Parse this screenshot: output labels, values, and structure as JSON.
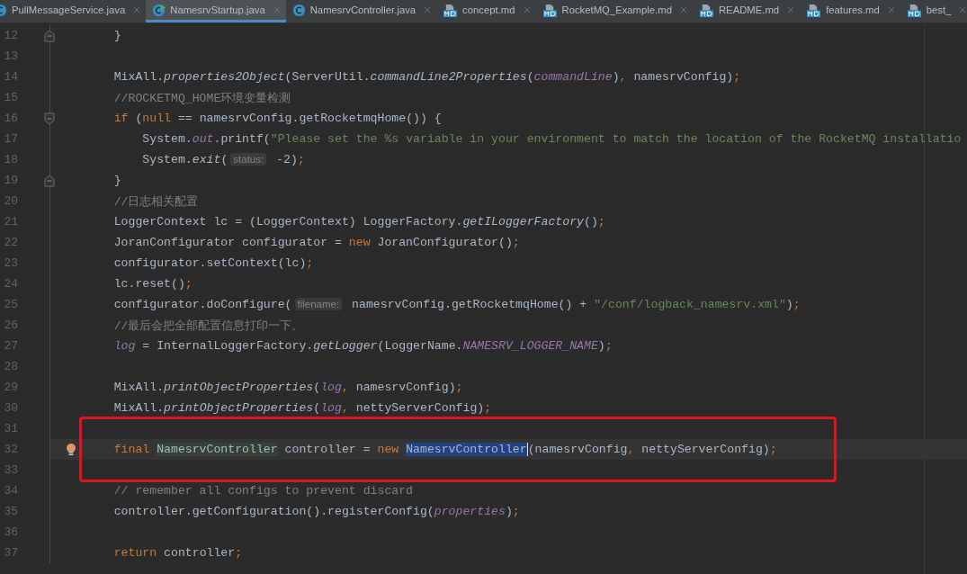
{
  "tabs": [
    {
      "label": "PullMessageService.java",
      "kind": "class",
      "selected": false
    },
    {
      "label": "NamesrvStartup.java",
      "kind": "runnable",
      "selected": true
    },
    {
      "label": "NamesrvController.java",
      "kind": "class",
      "selected": false
    },
    {
      "label": "concept.md",
      "kind": "markdown",
      "selected": false
    },
    {
      "label": "RocketMQ_Example.md",
      "kind": "markdown",
      "selected": false
    },
    {
      "label": "README.md",
      "kind": "markdown",
      "selected": false
    },
    {
      "label": "features.md",
      "kind": "markdown",
      "selected": false
    },
    {
      "label": "best_",
      "kind": "markdown",
      "selected": false
    }
  ],
  "editor": {
    "lines": [
      {
        "number": "12",
        "kind": "closer",
        "tokens": [
          {
            "kind": "plain",
            "text": "    }"
          }
        ]
      },
      {
        "number": "13",
        "kind": "plain"
      },
      {
        "number": "14",
        "kind": "plain",
        "tokens": [
          {
            "kind": "plain",
            "text": "    MixAll."
          },
          {
            "kind": "method",
            "text": "properties2Object"
          },
          {
            "kind": "plain",
            "text": "(ServerUtil."
          },
          {
            "kind": "method",
            "text": "commandLine2Properties"
          },
          {
            "kind": "plain",
            "text": "("
          },
          {
            "kind": "field",
            "text": "commandLine"
          },
          {
            "kind": "plain",
            "text": ")"
          },
          {
            "kind": "punct",
            "text": ", "
          },
          {
            "kind": "plain",
            "text": "namesrvConfig)"
          },
          {
            "kind": "punct",
            "text": ";"
          }
        ]
      },
      {
        "number": "15",
        "kind": "plain",
        "tokens": [
          {
            "kind": "comment",
            "text": "    //ROCKETMQ_HOME环境变量检测"
          }
        ]
      },
      {
        "number": "16",
        "kind": "opener",
        "tokens": [
          {
            "kind": "keyword",
            "text": "    if "
          },
          {
            "kind": "plain",
            "text": "("
          },
          {
            "kind": "keyword",
            "text": "null "
          },
          {
            "kind": "plain",
            "text": "== namesrvConfig.getRocketmqHome()) {"
          }
        ]
      },
      {
        "number": "17",
        "kind": "plain",
        "tokens": [
          {
            "kind": "plain",
            "text": "        System."
          },
          {
            "kind": "field",
            "text": "out"
          },
          {
            "kind": "plain",
            "text": ".printf("
          },
          {
            "kind": "string",
            "text": "\"Please set the %s variable in your environment to match the location of the RocketMQ installatio"
          }
        ]
      },
      {
        "number": "18",
        "kind": "plain",
        "tokens": [
          {
            "kind": "plain",
            "text": "        System."
          },
          {
            "kind": "method",
            "text": "exit"
          },
          {
            "kind": "plain",
            "text": "("
          },
          {
            "kind": "hint",
            "text": "status:"
          },
          {
            "kind": "plain",
            "text": " -2)"
          },
          {
            "kind": "punct",
            "text": ";"
          }
        ]
      },
      {
        "number": "19",
        "kind": "closer",
        "tokens": [
          {
            "kind": "plain",
            "text": "    }"
          }
        ]
      },
      {
        "number": "20",
        "kind": "plain",
        "tokens": [
          {
            "kind": "comment",
            "text": "    //日志相关配置"
          }
        ]
      },
      {
        "number": "21",
        "kind": "plain",
        "tokens": [
          {
            "kind": "plain",
            "text": "    LoggerContext lc = (LoggerContext) LoggerFactory."
          },
          {
            "kind": "method",
            "text": "getILoggerFactory"
          },
          {
            "kind": "plain",
            "text": "()"
          },
          {
            "kind": "punct",
            "text": ";"
          }
        ]
      },
      {
        "number": "22",
        "kind": "plain",
        "tokens": [
          {
            "kind": "plain",
            "text": "    JoranConfigurator configurator = "
          },
          {
            "kind": "keyword",
            "text": "new "
          },
          {
            "kind": "plain",
            "text": "JoranConfigurator()"
          },
          {
            "kind": "punct",
            "text": ";"
          }
        ]
      },
      {
        "number": "23",
        "kind": "plain",
        "tokens": [
          {
            "kind": "plain",
            "text": "    configurator.setContext(lc)"
          },
          {
            "kind": "punct",
            "text": ";"
          }
        ]
      },
      {
        "number": "24",
        "kind": "plain",
        "tokens": [
          {
            "kind": "plain",
            "text": "    lc.reset()"
          },
          {
            "kind": "punct",
            "text": ";"
          }
        ]
      },
      {
        "number": "25",
        "kind": "plain",
        "tokens": [
          {
            "kind": "plain",
            "text": "    configurator.doConfigure("
          },
          {
            "kind": "hint",
            "text": "filename:"
          },
          {
            "kind": "plain",
            "text": " namesrvConfig.getRocketmqHome() + "
          },
          {
            "kind": "string",
            "text": "\"/conf/logback_namesrv.xml\""
          },
          {
            "kind": "plain",
            "text": ")"
          },
          {
            "kind": "punct",
            "text": ";"
          }
        ]
      },
      {
        "number": "26",
        "kind": "plain",
        "tokens": [
          {
            "kind": "comment",
            "text": "    //最后会把全部配置信息打印一下。"
          }
        ]
      },
      {
        "number": "27",
        "kind": "plain",
        "tokens": [
          {
            "kind": "field",
            "text": "    log"
          },
          {
            "kind": "plain",
            "text": " = InternalLoggerFactory."
          },
          {
            "kind": "method",
            "text": "getLogger"
          },
          {
            "kind": "plain",
            "text": "(LoggerName."
          },
          {
            "kind": "field",
            "text": "NAMESRV_LOGGER_NAME"
          },
          {
            "kind": "plain",
            "text": ")"
          },
          {
            "kind": "punct",
            "text": ";"
          }
        ]
      },
      {
        "number": "28",
        "kind": "plain"
      },
      {
        "number": "29",
        "kind": "plain",
        "tokens": [
          {
            "kind": "plain",
            "text": "    MixAll."
          },
          {
            "kind": "method",
            "text": "printObjectProperties"
          },
          {
            "kind": "plain",
            "text": "("
          },
          {
            "kind": "field",
            "text": "log"
          },
          {
            "kind": "punct",
            "text": ", "
          },
          {
            "kind": "plain",
            "text": "namesrvConfig)"
          },
          {
            "kind": "punct",
            "text": ";"
          }
        ]
      },
      {
        "number": "30",
        "kind": "plain",
        "tokens": [
          {
            "kind": "plain",
            "text": "    MixAll."
          },
          {
            "kind": "method",
            "text": "printObjectProperties"
          },
          {
            "kind": "plain",
            "text": "("
          },
          {
            "kind": "field",
            "text": "log"
          },
          {
            "kind": "punct",
            "text": ", "
          },
          {
            "kind": "plain",
            "text": "nettyServerConfig)"
          },
          {
            "kind": "punct",
            "text": ";"
          }
        ]
      },
      {
        "number": "31",
        "kind": "plain"
      },
      {
        "number": "32",
        "kind": "plain",
        "current": true,
        "boxed": true,
        "bulb": true,
        "tokens": [
          {
            "kind": "keyword",
            "text": "    final "
          },
          {
            "kind": "usage",
            "text": "NamesrvController"
          },
          {
            "kind": "plain",
            "text": " controller = "
          },
          {
            "kind": "keyword",
            "text": "new "
          },
          {
            "kind": "selection",
            "text": "NamesrvController"
          },
          {
            "kind": "plain",
            "text": "(namesrvConfig"
          },
          {
            "kind": "punct",
            "text": ", "
          },
          {
            "kind": "plain",
            "text": "nettyServerConfig)"
          },
          {
            "kind": "punct",
            "text": ";"
          }
        ]
      },
      {
        "number": "33",
        "kind": "plain"
      },
      {
        "number": "34",
        "kind": "plain",
        "tokens": [
          {
            "kind": "comment",
            "text": "    // remember all configs to prevent discard"
          }
        ]
      },
      {
        "number": "35",
        "kind": "plain",
        "tokens": [
          {
            "kind": "plain",
            "text": "    controller.getConfiguration().registerConfig("
          },
          {
            "kind": "field",
            "text": "properties"
          },
          {
            "kind": "plain",
            "text": ")"
          },
          {
            "kind": "punct",
            "text": ";"
          }
        ]
      },
      {
        "number": "36",
        "kind": "plain"
      },
      {
        "number": "37",
        "kind": "plain",
        "tokens": [
          {
            "kind": "keyword",
            "text": "    return "
          },
          {
            "kind": "plain",
            "text": "controller"
          },
          {
            "kind": "punct",
            "text": ";"
          }
        ]
      }
    ]
  }
}
